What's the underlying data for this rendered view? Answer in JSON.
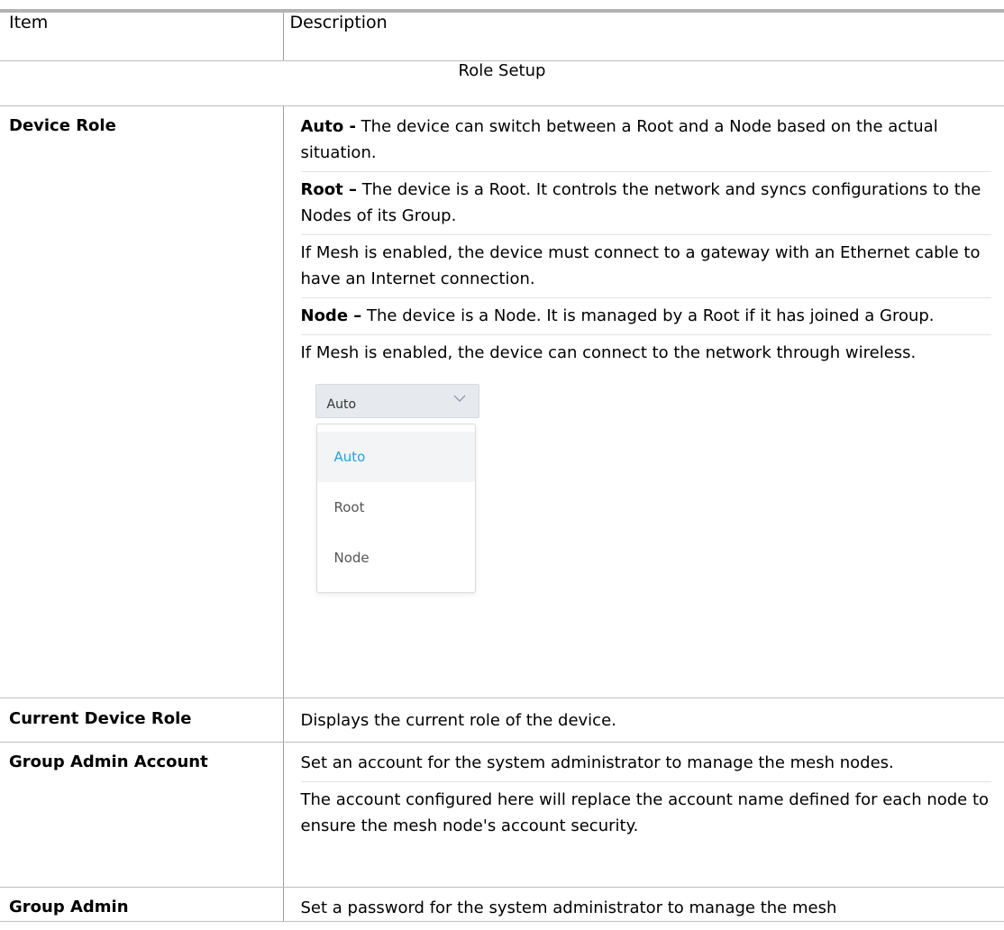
{
  "table": {
    "header": {
      "item": "Item",
      "description": "Description"
    },
    "section_title": "Role Setup",
    "rows": [
      {
        "name": "Device Role",
        "paragraphs": [
          {
            "term": "Auto -",
            "text": " The device can switch between a Root and a Node based on the actual situation."
          },
          {
            "term": "Root –",
            "text": " The device is a Root. It controls the network and syncs configurations to the Nodes of its Group."
          },
          {
            "term": "",
            "text": "If Mesh is enabled, the device must connect to a gateway with an Ethernet cable to have an Internet connection."
          },
          {
            "term": "Node –",
            "text": " The device is a Node. It is managed by a Root if it has joined a Group."
          },
          {
            "term": "",
            "text": "If Mesh is enabled, the device can connect to the network through wireless."
          }
        ],
        "dropdown": {
          "selected": "Auto",
          "options": [
            "Auto",
            "Root",
            "Node"
          ],
          "icon": "chevron-down-icon",
          "selected_color": "#2a9fe0"
        }
      },
      {
        "name": "Current Device Role",
        "text": "Displays the current role of the device."
      },
      {
        "name": "Group Admin Account",
        "paragraphs": [
          "Set an account for the system administrator to manage the mesh nodes.",
          "The account configured here will replace the account name defined for each node to ensure the mesh node's account security."
        ]
      },
      {
        "name": "Group Admin",
        "text": "Set a password for the system administrator to manage the mesh"
      }
    ]
  }
}
